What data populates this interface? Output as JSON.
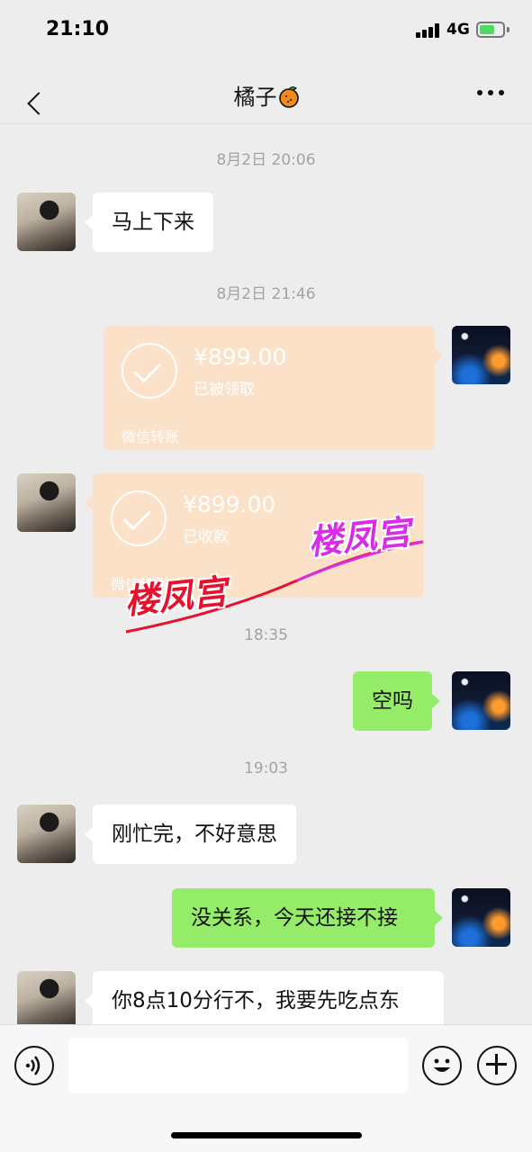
{
  "status_bar": {
    "time": "21:10",
    "network": "4G"
  },
  "header": {
    "title": "橘子"
  },
  "messages": [
    {
      "type": "timestamp",
      "text": "8月2日 20:06"
    },
    {
      "type": "text",
      "side": "left",
      "text": "马上下来"
    },
    {
      "type": "timestamp",
      "text": "8月2日 21:46"
    },
    {
      "type": "transfer",
      "side": "right",
      "amount": "¥899.00",
      "status": "已被领取",
      "label": "微信转账"
    },
    {
      "type": "transfer",
      "side": "left",
      "amount": "¥899.00",
      "status": "已收款",
      "label": "微信转账"
    },
    {
      "type": "timestamp",
      "text": "18:35"
    },
    {
      "type": "text",
      "side": "right",
      "text": "空吗"
    },
    {
      "type": "timestamp",
      "text": "19:03"
    },
    {
      "type": "text",
      "side": "left",
      "text": "刚忙完，不好意思"
    },
    {
      "type": "text",
      "side": "right",
      "text": "没关系，今天还接不接"
    },
    {
      "type": "text",
      "side": "left",
      "text": "你8点10分行不，我要先吃点东"
    }
  ],
  "watermark": {
    "text_1": "楼凤宫",
    "text_2": "楼凤宫"
  },
  "input": {
    "value": "",
    "placeholder": ""
  },
  "colors": {
    "background": "#ededed",
    "my_bubble": "#95ec69",
    "their_bubble": "#ffffff",
    "transfer_card": "#fbe1c8",
    "timestamp": "#a3a3a3"
  },
  "icons": [
    "back-icon",
    "orange-icon",
    "more-icon",
    "voice-icon",
    "emoji-icon",
    "plus-icon"
  ]
}
